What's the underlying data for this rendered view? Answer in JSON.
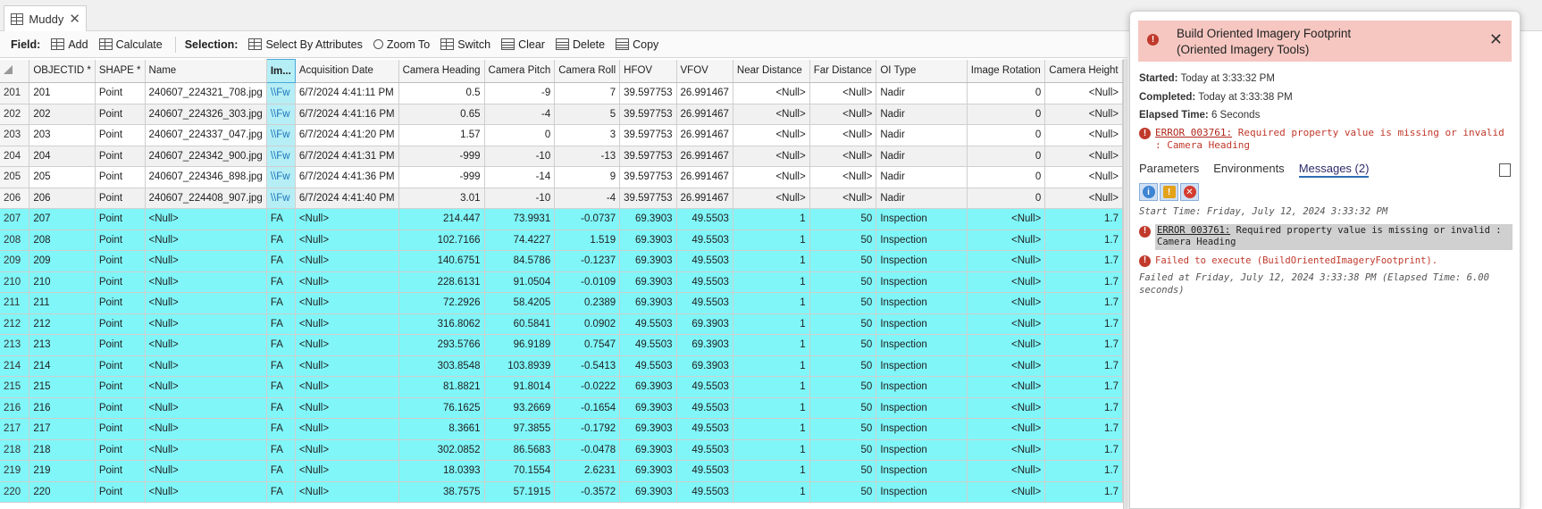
{
  "tab": {
    "title": "Muddy"
  },
  "toolbar": {
    "field_label": "Field:",
    "add": "Add",
    "calculate": "Calculate",
    "selection_label": "Selection:",
    "select_by_attributes": "Select By Attributes",
    "zoom_to": "Zoom To",
    "switch": "Switch",
    "clear": "Clear",
    "delete": "Delete",
    "copy": "Copy"
  },
  "table": {
    "columns": [
      "OBJECTID *",
      "SHAPE *",
      "Name",
      "Im...",
      "Acquisition Date",
      "Camera Heading",
      "Camera Pitch",
      "Camera Roll",
      "HFOV",
      "VFOV",
      "Near Distance",
      "Far Distance",
      "OI Type",
      "Image Rotation",
      "Camera Height"
    ],
    "rows": [
      {
        "row": "201",
        "cells": [
          "201",
          "Point",
          "240607_224321_708.jpg",
          "\\\\Fw",
          "6/7/2024 4:41:11 PM",
          "0.5",
          "-9",
          "7",
          "39.597753",
          "26.991467",
          "<Null>",
          "<Null>",
          "Nadir",
          "0",
          "<Null>"
        ]
      },
      {
        "row": "202",
        "cells": [
          "202",
          "Point",
          "240607_224326_303.jpg",
          "\\\\Fw",
          "6/7/2024 4:41:16 PM",
          "0.65",
          "-4",
          "5",
          "39.597753",
          "26.991467",
          "<Null>",
          "<Null>",
          "Nadir",
          "0",
          "<Null>"
        ]
      },
      {
        "row": "203",
        "cells": [
          "203",
          "Point",
          "240607_224337_047.jpg",
          "\\\\Fw",
          "6/7/2024 4:41:20 PM",
          "1.57",
          "0",
          "3",
          "39.597753",
          "26.991467",
          "<Null>",
          "<Null>",
          "Nadir",
          "0",
          "<Null>"
        ]
      },
      {
        "row": "204",
        "cells": [
          "204",
          "Point",
          "240607_224342_900.jpg",
          "\\\\Fw",
          "6/7/2024 4:41:31 PM",
          "-999",
          "-10",
          "-13",
          "39.597753",
          "26.991467",
          "<Null>",
          "<Null>",
          "Nadir",
          "0",
          "<Null>"
        ]
      },
      {
        "row": "205",
        "cells": [
          "205",
          "Point",
          "240607_224346_898.jpg",
          "\\\\Fw",
          "6/7/2024 4:41:36 PM",
          "-999",
          "-14",
          "9",
          "39.597753",
          "26.991467",
          "<Null>",
          "<Null>",
          "Nadir",
          "0",
          "<Null>"
        ]
      },
      {
        "row": "206",
        "cells": [
          "206",
          "Point",
          "240607_224408_907.jpg",
          "\\\\Fw",
          "6/7/2024 4:41:40 PM",
          "3.01",
          "-10",
          "-4",
          "39.597753",
          "26.991467",
          "<Null>",
          "<Null>",
          "Nadir",
          "0",
          "<Null>"
        ]
      },
      {
        "row": "207",
        "cells": [
          "207",
          "Point",
          "<Null>",
          "FA",
          "<Null>",
          "214.447",
          "73.9931",
          "-0.0737",
          "69.3903",
          "49.5503",
          "1",
          "50",
          "Inspection",
          "<Null>",
          "1.7"
        ]
      },
      {
        "row": "208",
        "cells": [
          "208",
          "Point",
          "<Null>",
          "FA",
          "<Null>",
          "102.7166",
          "74.4227",
          "1.519",
          "69.3903",
          "49.5503",
          "1",
          "50",
          "Inspection",
          "<Null>",
          "1.7"
        ]
      },
      {
        "row": "209",
        "cells": [
          "209",
          "Point",
          "<Null>",
          "FA",
          "<Null>",
          "140.6751",
          "84.5786",
          "-0.1237",
          "69.3903",
          "49.5503",
          "1",
          "50",
          "Inspection",
          "<Null>",
          "1.7"
        ]
      },
      {
        "row": "210",
        "cells": [
          "210",
          "Point",
          "<Null>",
          "FA",
          "<Null>",
          "228.6131",
          "91.0504",
          "-0.0109",
          "69.3903",
          "49.5503",
          "1",
          "50",
          "Inspection",
          "<Null>",
          "1.7"
        ]
      },
      {
        "row": "211",
        "cells": [
          "211",
          "Point",
          "<Null>",
          "FA",
          "<Null>",
          "72.2926",
          "58.4205",
          "0.2389",
          "69.3903",
          "49.5503",
          "1",
          "50",
          "Inspection",
          "<Null>",
          "1.7"
        ]
      },
      {
        "row": "212",
        "cells": [
          "212",
          "Point",
          "<Null>",
          "FA",
          "<Null>",
          "316.8062",
          "60.5841",
          "0.0902",
          "49.5503",
          "69.3903",
          "1",
          "50",
          "Inspection",
          "<Null>",
          "1.7"
        ]
      },
      {
        "row": "213",
        "cells": [
          "213",
          "Point",
          "<Null>",
          "FA",
          "<Null>",
          "293.5766",
          "96.9189",
          "0.7547",
          "49.5503",
          "69.3903",
          "1",
          "50",
          "Inspection",
          "<Null>",
          "1.7"
        ]
      },
      {
        "row": "214",
        "cells": [
          "214",
          "Point",
          "<Null>",
          "FA",
          "<Null>",
          "303.8548",
          "103.8939",
          "-0.5413",
          "49.5503",
          "69.3903",
          "1",
          "50",
          "Inspection",
          "<Null>",
          "1.7"
        ]
      },
      {
        "row": "215",
        "cells": [
          "215",
          "Point",
          "<Null>",
          "FA",
          "<Null>",
          "81.8821",
          "91.8014",
          "-0.0222",
          "69.3903",
          "49.5503",
          "1",
          "50",
          "Inspection",
          "<Null>",
          "1.7"
        ]
      },
      {
        "row": "216",
        "cells": [
          "216",
          "Point",
          "<Null>",
          "FA",
          "<Null>",
          "76.1625",
          "93.2669",
          "-0.1654",
          "69.3903",
          "49.5503",
          "1",
          "50",
          "Inspection",
          "<Null>",
          "1.7"
        ]
      },
      {
        "row": "217",
        "cells": [
          "217",
          "Point",
          "<Null>",
          "FA",
          "<Null>",
          "8.3661",
          "97.3855",
          "-0.1792",
          "69.3903",
          "49.5503",
          "1",
          "50",
          "Inspection",
          "<Null>",
          "1.7"
        ]
      },
      {
        "row": "218",
        "cells": [
          "218",
          "Point",
          "<Null>",
          "FA",
          "<Null>",
          "302.0852",
          "86.5683",
          "-0.0478",
          "69.3903",
          "49.5503",
          "1",
          "50",
          "Inspection",
          "<Null>",
          "1.7"
        ]
      },
      {
        "row": "219",
        "cells": [
          "219",
          "Point",
          "<Null>",
          "FA",
          "<Null>",
          "18.0393",
          "70.1554",
          "2.6231",
          "69.3903",
          "49.5503",
          "1",
          "50",
          "Inspection",
          "<Null>",
          "1.7"
        ]
      },
      {
        "row": "220",
        "cells": [
          "220",
          "Point",
          "<Null>",
          "FA",
          "<Null>",
          "38.7575",
          "57.1915",
          "-0.3572",
          "69.3903",
          "49.5503",
          "1",
          "50",
          "Inspection",
          "<Null>",
          "1.7"
        ]
      }
    ]
  },
  "panel": {
    "title_line1": "Build Oriented Imagery Footprint",
    "title_line2": "(Oriented Imagery Tools)",
    "started_label": "Started:",
    "started_value": "Today at 3:33:32 PM",
    "completed_label": "Completed:",
    "completed_value": "Today at 3:33:38 PM",
    "elapsed_label": "Elapsed Time:",
    "elapsed_value": "6 Seconds",
    "error_code": "ERROR 003761:",
    "error_text": "Required property value is missing or invalid : Camera Heading",
    "tabs": {
      "parameters": "Parameters",
      "environments": "Environments",
      "messages": "Messages (2)"
    },
    "log": {
      "start": "Start Time: Friday, July 12, 2024 3:33:32 PM",
      "error_code": "ERROR 003761:",
      "error_text": "Required property value is missing or invalid : Camera Heading",
      "failed": "Failed to execute (BuildOrientedImageryFootprint).",
      "end": "Failed at Friday, July 12, 2024 3:33:38 PM (Elapsed Time: 6.00 seconds)"
    }
  },
  "colors": {
    "highlight": "#80f6f8",
    "error": "#c0392b",
    "header_error_bg": "#f6c7c1"
  }
}
